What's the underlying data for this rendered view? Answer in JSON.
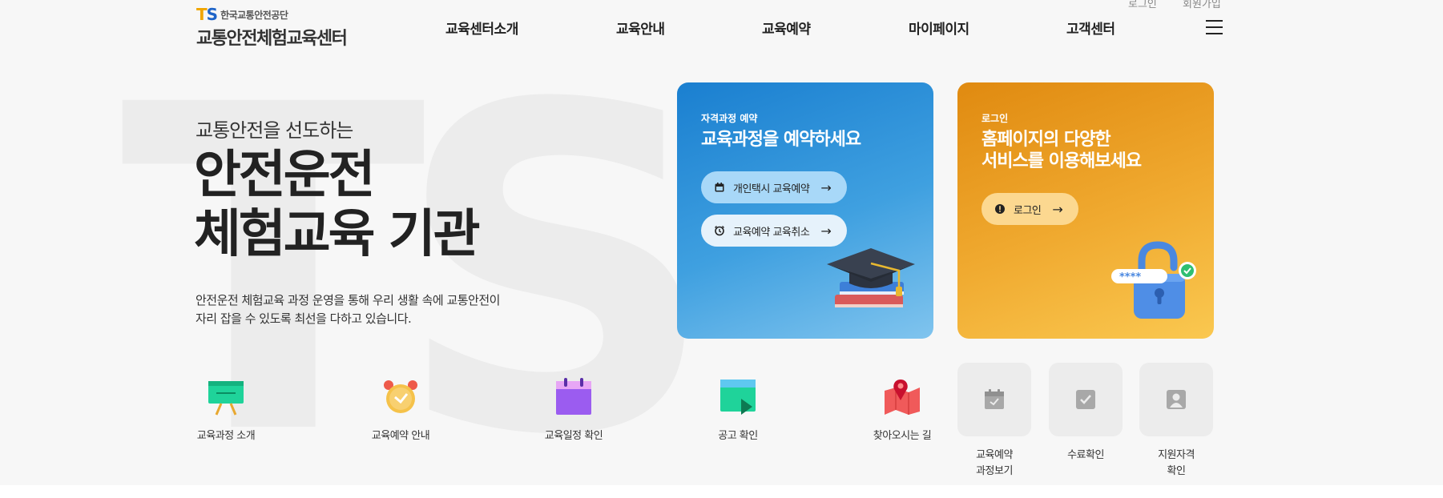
{
  "header": {
    "util_links": [
      "로그인",
      "회원가입"
    ],
    "logo": {
      "mark_t": "T",
      "mark_s": "S",
      "org": "한국교통안전공단",
      "name": "교통안전체험교육센터"
    },
    "nav": [
      "교육센터소개",
      "교육안내",
      "교육예약",
      "마이페이지",
      "고객센터"
    ]
  },
  "hero": {
    "sub": "교통안전을 선도하는",
    "title_line1": "안전운전",
    "title_line2": "체험교육 기관",
    "desc_line1": "안전운전 체험교육 과정 운영을 통해 우리 생활 속에 교통안전이",
    "desc_line2": "자리 잡을 수 있도록 최선을 다하고 있습니다.",
    "bg_text": "TS"
  },
  "card_reserve": {
    "label": "자격과정 예약",
    "title": "교육과정을 예약하세요",
    "button1": "개인택시 교육예약",
    "button2": "교육예약 교육취소",
    "arrow": "→"
  },
  "card_login": {
    "label": "로그인",
    "title_line1": "홈페이지의 다양한",
    "title_line2": "서비스를 이용해보세요",
    "button": "로그인",
    "arrow": "→",
    "password_mask": "****"
  },
  "quick_menu": [
    {
      "label": "교육과정 소개",
      "icon": "blackboard-icon"
    },
    {
      "label": "교육예약 안내",
      "icon": "alarm-clock-icon"
    },
    {
      "label": "교육일정 확인",
      "icon": "calendar-icon"
    },
    {
      "label": "공고 확인",
      "icon": "notice-board-icon"
    },
    {
      "label": "찾아오시는 길",
      "icon": "map-pin-icon"
    }
  ],
  "tiles": [
    {
      "line1": "교육예약",
      "line2": "과정보기",
      "icon": "calendar-icon"
    },
    {
      "line1": "수료확인",
      "line2": "",
      "icon": "check-icon"
    },
    {
      "line1": "지원자격",
      "line2": "확인",
      "icon": "person-icon"
    }
  ],
  "colors": {
    "blue_card": "#1a7fd0",
    "orange_card": "#e08a10",
    "logo_orange": "#f0a500",
    "logo_blue": "#1e64c8"
  }
}
